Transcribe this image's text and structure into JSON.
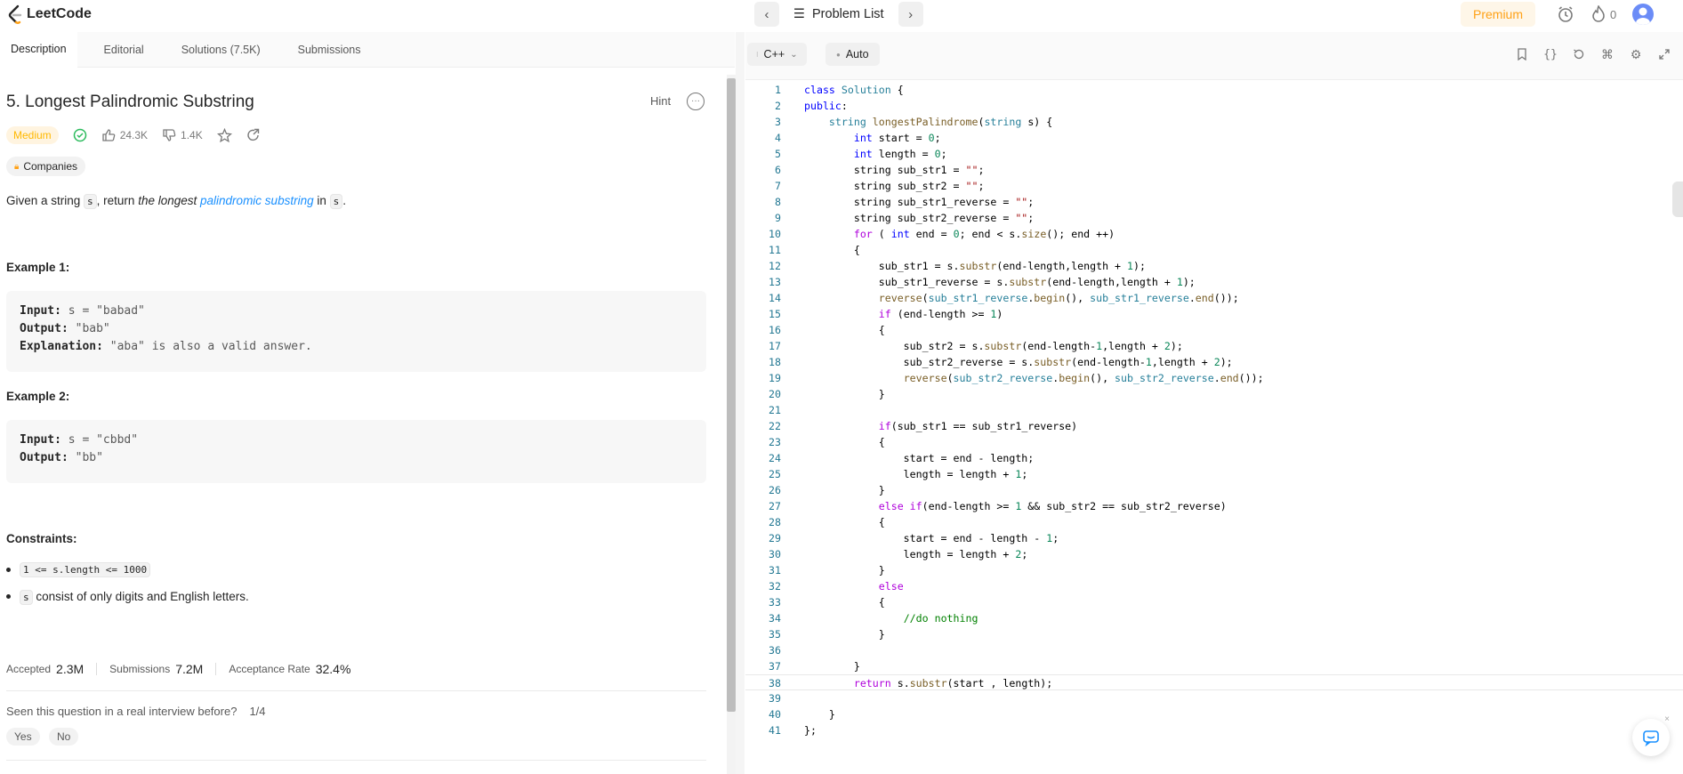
{
  "app": {
    "logo_text": "LeetCode"
  },
  "topbar": {
    "problem_list": "Problem List",
    "premium": "Premium",
    "streak_count": "0"
  },
  "tabs": [
    "Description",
    "Editorial",
    "Solutions (7.5K)",
    "Submissions"
  ],
  "problem": {
    "title": "5. Longest Palindromic Substring",
    "hint": "Hint",
    "difficulty": "Medium",
    "likes": "24.3K",
    "dislikes": "1.4K",
    "companies": "Companies",
    "desc_pre": "Given a string ",
    "desc_var": "s",
    "desc_mid": ", return ",
    "desc_em": "the longest",
    "desc_link": "palindromic substring",
    "desc_in": " in ",
    "desc_var2": "s",
    "desc_end": "."
  },
  "examples": [
    {
      "heading": "Example 1:",
      "input_label": "Input:",
      "input": " s = \"babad\"",
      "output_label": "Output:",
      "output": " \"bab\"",
      "expl_label": "Explanation:",
      "expl": " \"aba\" is also a valid answer."
    },
    {
      "heading": "Example 2:",
      "input_label": "Input:",
      "input": " s = \"cbbd\"",
      "output_label": "Output:",
      "output": " \"bb\""
    }
  ],
  "constraints": {
    "heading": "Constraints:",
    "c1": "1 <= s.length <= 1000",
    "c2_var": "s",
    "c2_text": "consist of only digits and English letters."
  },
  "stats": {
    "accepted_label": "Accepted",
    "accepted": "2.3M",
    "submissions_label": "Submissions",
    "submissions": "7.2M",
    "rate_label": "Acceptance Rate",
    "rate": "32.4%"
  },
  "interview": {
    "question": "Seen this question in a real interview before?",
    "fraction": "1/4",
    "yes": "Yes",
    "no": "No"
  },
  "editor": {
    "language": "C++",
    "mode": "Auto"
  },
  "colors": {
    "accent": "#ffa116",
    "link": "#1a90ff",
    "medium": "#ffb800",
    "keyword": "#0000ff",
    "type": "#267f99",
    "function": "#795e26",
    "control": "#af00db",
    "number": "#098658",
    "string": "#a31515",
    "comment": "#008000"
  }
}
